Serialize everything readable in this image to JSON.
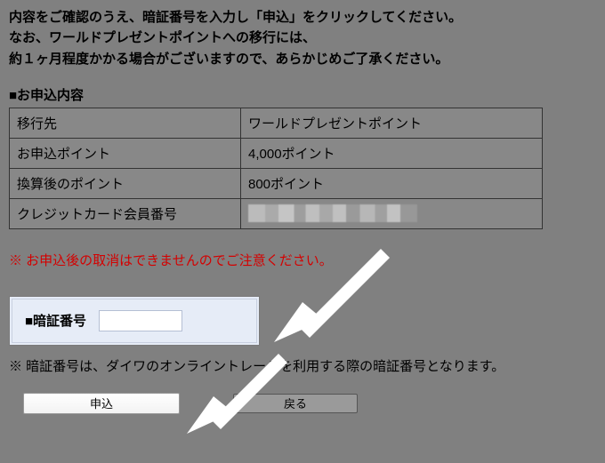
{
  "intro": {
    "line1": "内容をご確認のうえ、暗証番号を入力し「申込」をクリックしてください。",
    "line2": "なお、ワールドプレゼントポイントへの移行には、",
    "line3": "約１ヶ月程度かかる場合がございますので、あらかじめご了承ください。"
  },
  "section_title": "■お申込内容",
  "table": {
    "rows": [
      {
        "label": "移行先",
        "value": "ワールドプレゼントポイント"
      },
      {
        "label": "お申込ポイント",
        "value": "4,000ポイント"
      },
      {
        "label": "換算後のポイント",
        "value": "800ポイント"
      },
      {
        "label": "クレジットカード会員番号",
        "value": ""
      }
    ]
  },
  "warning_text": "※ お申込後の取消はできませんのでご注意ください。",
  "pin": {
    "label": "■暗証番号",
    "value": "",
    "note": "※ 暗証番号は、ダイワのオンライントレードを利用する際の暗証番号となります。"
  },
  "buttons": {
    "apply": "申込",
    "back": "戻る"
  }
}
